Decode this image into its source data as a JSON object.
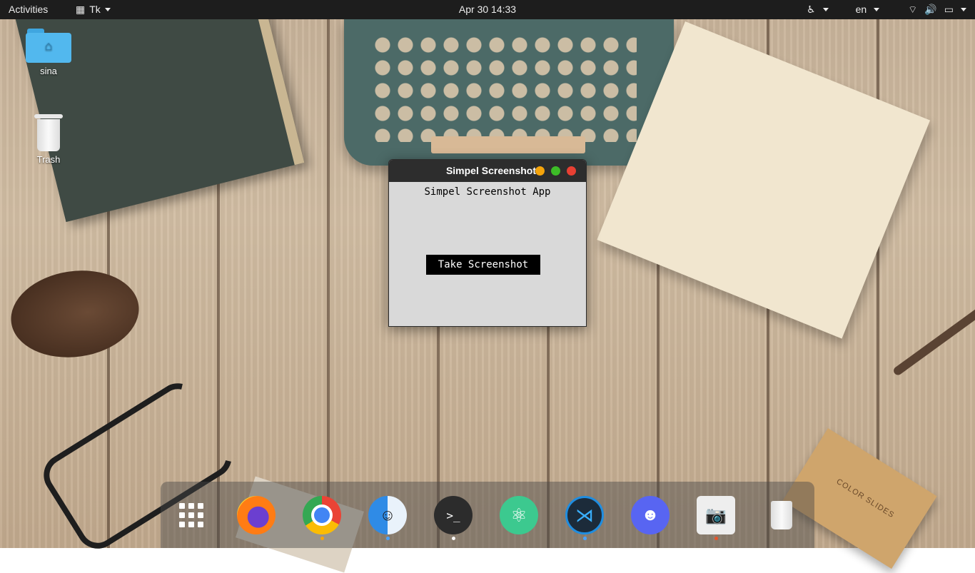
{
  "topbar": {
    "activities": "Activities",
    "app_menu": "Tk",
    "clock": "Apr 30  14:33",
    "language": "en",
    "icons": [
      "accessibility-icon",
      "wifi-icon",
      "volume-icon",
      "battery-icon"
    ]
  },
  "desktop": {
    "icons": [
      {
        "label": "sina",
        "icon": "home-folder-icon"
      },
      {
        "label": "Trash",
        "icon": "trash-icon"
      }
    ]
  },
  "window": {
    "title": "Simpel Screenshot",
    "heading": "Simpel Screenshot App",
    "button_label": "Take Screenshot",
    "controls": {
      "minimize": "#f5a40b",
      "maximize": "#3dbc27",
      "close": "#e84033"
    }
  },
  "dock": {
    "items": [
      {
        "name": "show-apps",
        "icon": "grid-icon"
      },
      {
        "name": "firefox",
        "icon": "firefox-icon"
      },
      {
        "name": "chrome",
        "icon": "chrome-icon",
        "running": true
      },
      {
        "name": "files",
        "icon": "finder-icon",
        "running": true
      },
      {
        "name": "terminal",
        "icon": "terminal-icon",
        "running": true
      },
      {
        "name": "atom",
        "icon": "atom-icon"
      },
      {
        "name": "vscode",
        "icon": "vscode-icon",
        "running": true
      },
      {
        "name": "discord",
        "icon": "discord-icon"
      },
      {
        "name": "screenshot",
        "icon": "screenshot-app-icon",
        "running": true
      },
      {
        "name": "trash",
        "icon": "trash-icon"
      }
    ],
    "terminal_glyph": ">_",
    "decor_text": "COLOR SLIDES"
  }
}
